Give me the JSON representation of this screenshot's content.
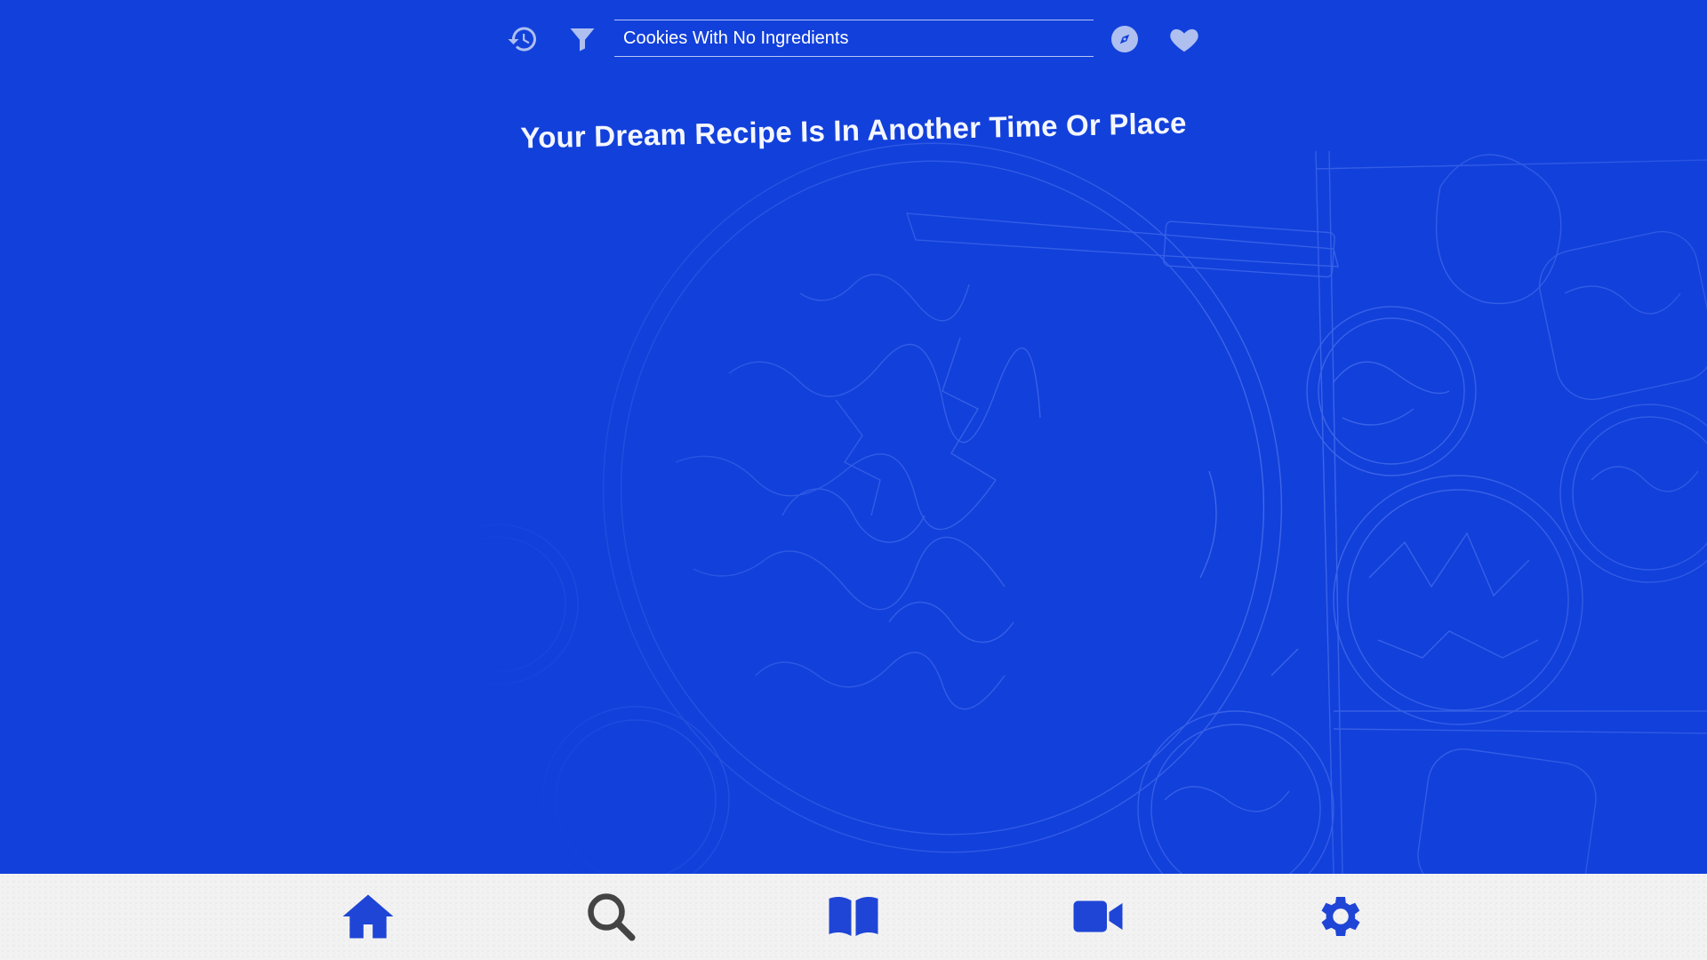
{
  "search": {
    "value": "Cookies With No Ingredients"
  },
  "headline": "Your Dream Recipe Is In Another Time Or Place",
  "icons": {
    "history": "history-icon",
    "filter": "filter-icon",
    "compass": "compass-icon",
    "favorites": "heart-icon"
  },
  "bottom_nav": {
    "items": [
      "home-icon",
      "search-icon",
      "book-icon",
      "video-icon",
      "gear-icon"
    ]
  },
  "colors": {
    "background": "#1240db",
    "topbar_icons": "#aebff0",
    "nav_active": "#1f45d6",
    "nav_inactive": "#444444",
    "nav_bar": "#f2f2f2"
  }
}
